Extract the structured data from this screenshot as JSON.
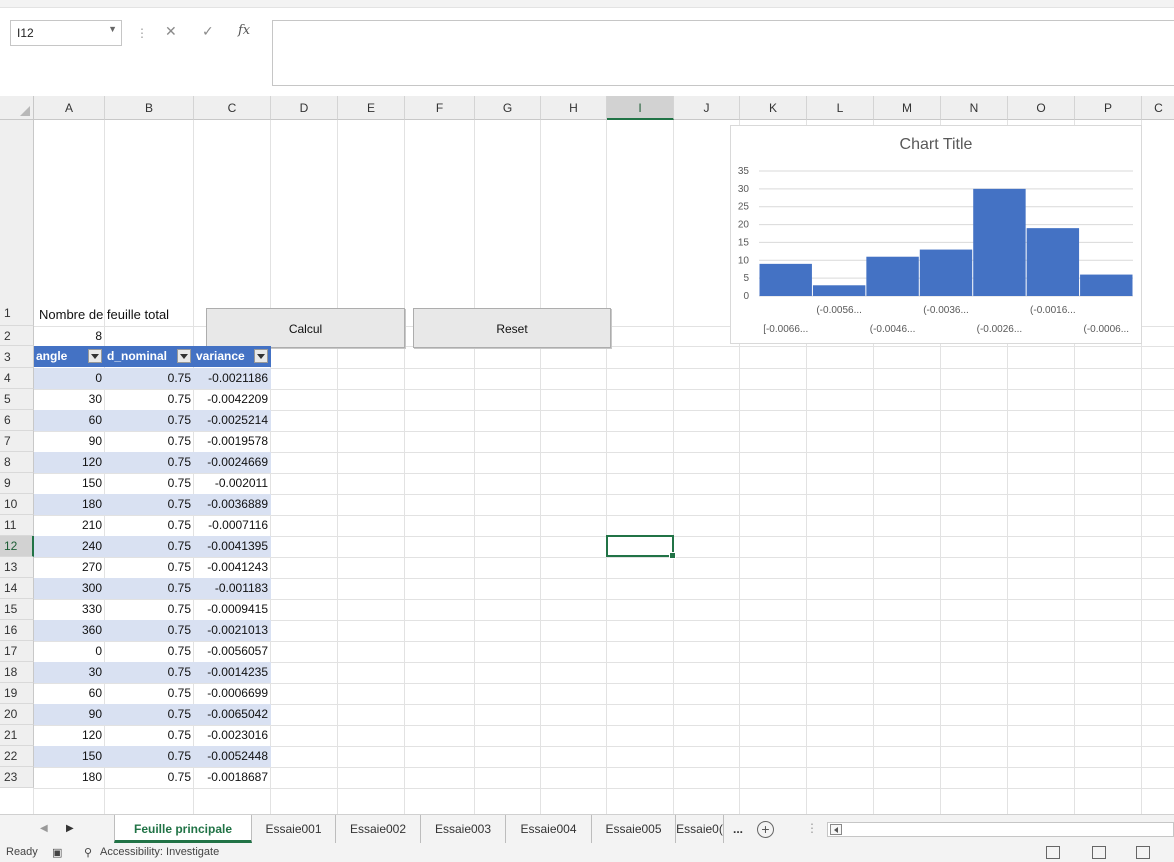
{
  "formula_bar": {
    "name_box": "I12",
    "cancel_glyph": "✕",
    "enter_glyph": "✓",
    "fx_glyph": "fx",
    "formula": ""
  },
  "columns": [
    "A",
    "B",
    "C",
    "D",
    "E",
    "F",
    "G",
    "H",
    "I",
    "J",
    "K",
    "L",
    "M",
    "N",
    "O",
    "P",
    "C"
  ],
  "selected_column": "I",
  "rows": [
    "1",
    "2",
    "3",
    "4",
    "5",
    "6",
    "7",
    "8",
    "9",
    "10",
    "11",
    "12",
    "13",
    "14",
    "15",
    "16",
    "17",
    "18",
    "19",
    "20",
    "21",
    "22",
    "23"
  ],
  "selected_row": "12",
  "cells": {
    "a1": "Nombre de feuille total",
    "a2": "8"
  },
  "buttons": {
    "calcul": "Calcul",
    "reset": "Reset"
  },
  "table": {
    "headers": [
      "angle",
      "d_nominal",
      "variance"
    ],
    "rows": [
      [
        "0",
        "0.75",
        "-0.0021186"
      ],
      [
        "30",
        "0.75",
        "-0.0042209"
      ],
      [
        "60",
        "0.75",
        "-0.0025214"
      ],
      [
        "90",
        "0.75",
        "-0.0019578"
      ],
      [
        "120",
        "0.75",
        "-0.0024669"
      ],
      [
        "150",
        "0.75",
        "-0.002011"
      ],
      [
        "180",
        "0.75",
        "-0.0036889"
      ],
      [
        "210",
        "0.75",
        "-0.0007116"
      ],
      [
        "240",
        "0.75",
        "-0.0041395"
      ],
      [
        "270",
        "0.75",
        "-0.0041243"
      ],
      [
        "300",
        "0.75",
        "-0.001183"
      ],
      [
        "330",
        "0.75",
        "-0.0009415"
      ],
      [
        "360",
        "0.75",
        "-0.0021013"
      ],
      [
        "0",
        "0.75",
        "-0.0056057"
      ],
      [
        "30",
        "0.75",
        "-0.0014235"
      ],
      [
        "60",
        "0.75",
        "-0.0006699"
      ],
      [
        "90",
        "0.75",
        "-0.0065042"
      ],
      [
        "120",
        "0.75",
        "-0.0023016"
      ],
      [
        "150",
        "0.75",
        "-0.0052448"
      ],
      [
        "180",
        "0.75",
        "-0.0018687"
      ]
    ]
  },
  "chart_data": {
    "type": "bar",
    "title": "Chart Title",
    "categories": [
      "[-0.0066...",
      "(-0.0056...",
      "(-0.0046...",
      "(-0.0036...",
      "(-0.0026...",
      "(-0.0016...",
      "(-0.0006..."
    ],
    "values": [
      9,
      3,
      11,
      13,
      30,
      19,
      6
    ],
    "ylim": [
      0,
      35
    ],
    "yticks": [
      "0",
      "5",
      "10",
      "15",
      "20",
      "25",
      "30",
      "35"
    ],
    "grid": true,
    "bar_color": "#4472c4"
  },
  "sheet_tabs": [
    "Feuille principale",
    "Essaie001",
    "Essaie002",
    "Essaie003",
    "Essaie004",
    "Essaie005",
    "Essaie0("
  ],
  "sheet_more": "...",
  "active_tab": "Feuille principale",
  "status_bar": {
    "ready": "Ready",
    "accessibility": "Accessibility: Investigate"
  },
  "accent_color": "#217346"
}
